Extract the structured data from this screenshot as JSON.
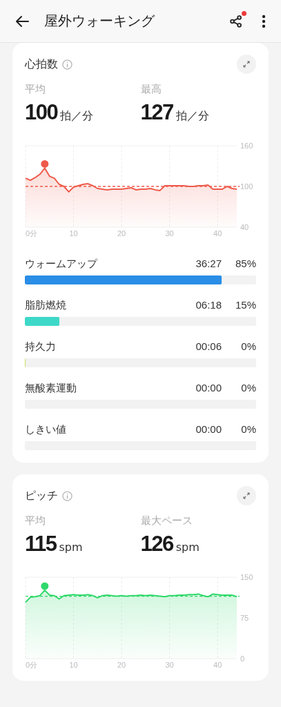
{
  "header": {
    "title": "屋外ウォーキング",
    "share_notification": true
  },
  "heart_rate": {
    "title": "心拍数",
    "stats": [
      {
        "label": "平均",
        "value": "100",
        "unit": "拍／分"
      },
      {
        "label": "最高",
        "value": "127",
        "unit": "拍／分"
      }
    ],
    "chart_data": {
      "type": "area",
      "x": [
        0,
        1,
        2,
        3,
        4,
        5,
        6,
        7,
        8,
        9,
        10,
        11,
        12,
        13,
        14,
        15,
        16,
        17,
        18,
        19,
        20,
        21,
        22,
        23,
        24,
        25,
        26,
        27,
        28,
        29,
        30,
        31,
        32,
        33,
        34,
        35,
        36,
        37,
        38,
        39,
        40,
        41,
        42,
        43,
        44
      ],
      "series": [
        {
          "color": "#ee5a4a",
          "values": [
            112,
            109,
            113,
            118,
            127,
            115,
            112,
            103,
            100,
            92,
            99,
            101,
            103,
            104,
            101,
            97,
            96,
            95,
            96,
            96,
            96,
            97,
            98,
            95,
            96,
            96,
            97,
            95,
            94,
            101,
            101,
            101,
            101,
            101,
            100,
            100,
            101,
            101,
            102,
            96,
            96,
            96,
            100,
            97,
            96
          ]
        }
      ],
      "xlim": [
        0,
        44
      ],
      "ylim": [
        40,
        160
      ],
      "xticks": [
        {
          "value": 0,
          "label": "0分"
        },
        10,
        20,
        30,
        40
      ],
      "yticks": [
        40,
        100,
        160
      ],
      "grid": true,
      "ref_lines": [
        {
          "axis": "y",
          "value": 100
        }
      ]
    },
    "zones": [
      {
        "name": "ウォームアップ",
        "time": "36:27",
        "percent": "85%",
        "level": 0.85,
        "color": "#2a8de6"
      },
      {
        "name": "脂肪燃焼",
        "time": "06:18",
        "percent": "15%",
        "level": 0.15,
        "color": "#3ed8c8"
      },
      {
        "name": "持久力",
        "time": "00:06",
        "percent": "0%",
        "level": 0.003,
        "color": "#c5e05a"
      },
      {
        "name": "無酸素運動",
        "time": "00:00",
        "percent": "0%"
      },
      {
        "name": "しきい値",
        "time": "00:00",
        "percent": "0%"
      }
    ]
  },
  "pitch": {
    "title": "ピッチ",
    "stats": [
      {
        "label": "平均",
        "value": "115",
        "unit": "spm"
      },
      {
        "label": "最大ペース",
        "value": "126",
        "unit": "spm"
      }
    ],
    "chart_data": {
      "type": "area",
      "x": [
        0,
        1,
        2,
        3,
        4,
        5,
        6,
        7,
        8,
        9,
        10,
        11,
        12,
        13,
        14,
        15,
        16,
        17,
        18,
        19,
        20,
        21,
        22,
        23,
        24,
        25,
        26,
        27,
        28,
        29,
        30,
        31,
        32,
        33,
        34,
        35,
        36,
        37,
        38,
        39,
        40,
        41,
        42,
        43,
        44
      ],
      "series": [
        {
          "color": "#2fd86a",
          "values": [
            104,
            113,
            114,
            116,
            126,
            117,
            116,
            110,
            116,
            117,
            118,
            117,
            117,
            118,
            116,
            112,
            116,
            117,
            116,
            115,
            116,
            115,
            116,
            116,
            117,
            116,
            117,
            116,
            115,
            114,
            116,
            116,
            117,
            117,
            118,
            118,
            119,
            116,
            114,
            119,
            118,
            117,
            117,
            117,
            114
          ]
        }
      ],
      "xlim": [
        0,
        44
      ],
      "ylim": [
        0,
        150
      ],
      "xticks": [
        {
          "value": 0,
          "label": "0分"
        },
        10,
        20,
        30,
        40
      ],
      "yticks": [
        0,
        75,
        150
      ],
      "grid": true,
      "ref_lines": [
        {
          "axis": "y",
          "value": 115
        }
      ]
    }
  }
}
